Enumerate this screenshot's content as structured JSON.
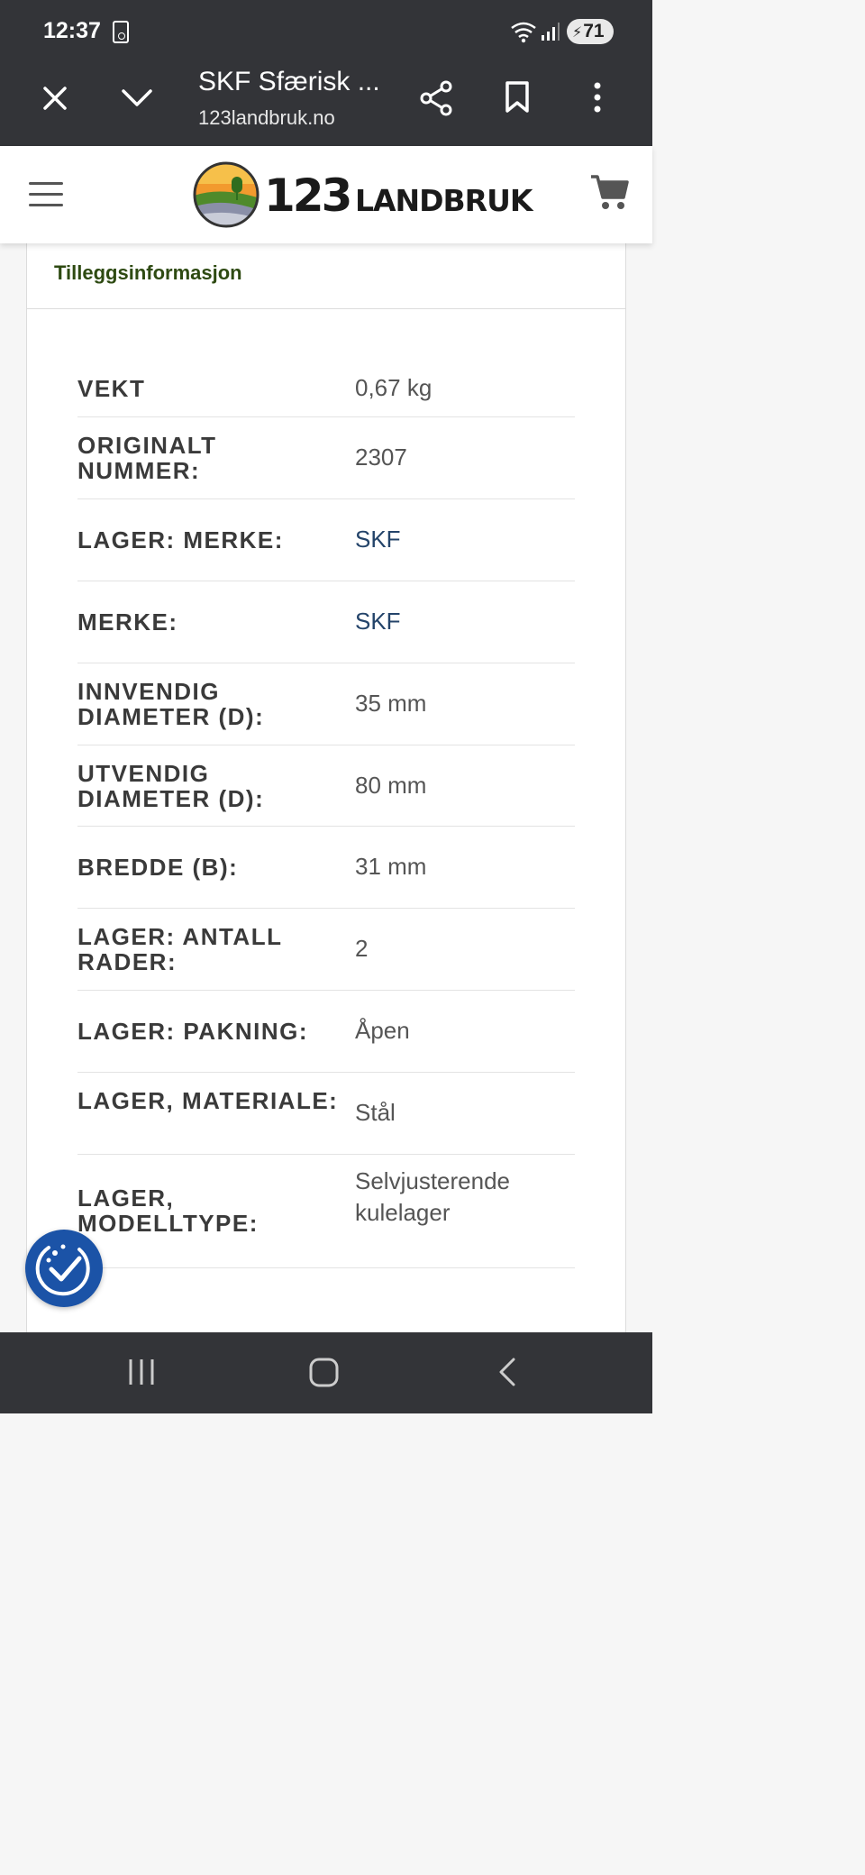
{
  "status_bar": {
    "time": "12:37",
    "battery": "71"
  },
  "browser": {
    "title": "SKF Sfærisk ...",
    "url": "123landbruk.no"
  },
  "site": {
    "logo_number": "123",
    "logo_word": "LANDBRUK"
  },
  "section": {
    "title": "Tilleggsinformasjon"
  },
  "attributes": [
    {
      "label": "VEKT",
      "value": "0,67 kg",
      "link": false
    },
    {
      "label": "ORIGINALT NUMMER:",
      "value": "2307",
      "link": false
    },
    {
      "label": "LAGER: MERKE:",
      "value": "SKF",
      "link": true
    },
    {
      "label": "MERKE:",
      "value": "SKF",
      "link": true
    },
    {
      "label": "INNVENDIG DIAMETER (D):",
      "value": "35 mm",
      "link": false
    },
    {
      "label": "UTVENDIG DIAMETER (D):",
      "value": "80 mm",
      "link": false
    },
    {
      "label": "BREDDE (B):",
      "value": "31 mm",
      "link": false
    },
    {
      "label": "LAGER: ANTALL RADER:",
      "value": "2",
      "link": false
    },
    {
      "label": "LAGER: PAKNING:",
      "value": "Åpen",
      "link": false
    },
    {
      "label": "LAGER, MATERIALE:",
      "value": "Stål",
      "link": false
    },
    {
      "label": "LAGER, MODELLTYPE:",
      "value": "Selvjusterende kulelager",
      "link": false
    }
  ],
  "colors": {
    "system_bar": "#333438",
    "section_title": "#2e4a12",
    "link": "#24446a",
    "badge": "#1b53a7"
  }
}
